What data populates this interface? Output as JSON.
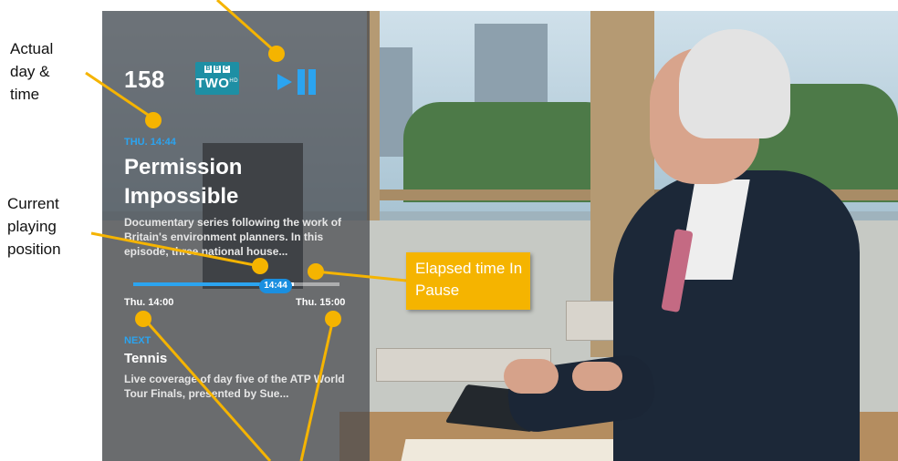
{
  "channel": {
    "number": "158",
    "logo_text": "TWO",
    "logo_sup": "HD",
    "logo_blocks": [
      "B",
      "B",
      "C"
    ],
    "logo_color": "#1e8fa4"
  },
  "playback": {
    "state_icon": "play-pause-icon",
    "accent_color": "#2ba4f0"
  },
  "current_program": {
    "actual_time": "THU. 14:44",
    "title": "Permission Impossible",
    "description": "Documentary series following the work of Britain's environment planners. In this episode, three national house...",
    "start_time": "Thu. 14:00",
    "end_time": "Thu. 15:00",
    "position_label": "14:44",
    "played_fraction": 0.68,
    "paused_elapsed_fraction": 0.1
  },
  "next_program": {
    "label": "NEXT",
    "title": "Tennis",
    "description": "Live coverage of day five of the ATP World Tour Finals, presented by Sue..."
  },
  "annotations": {
    "actual_day_time": "Actual day & time",
    "current_position": "Current playing position",
    "elapsed_pause": "Elapsed time In Pause",
    "marker_color": "#f5b400"
  }
}
